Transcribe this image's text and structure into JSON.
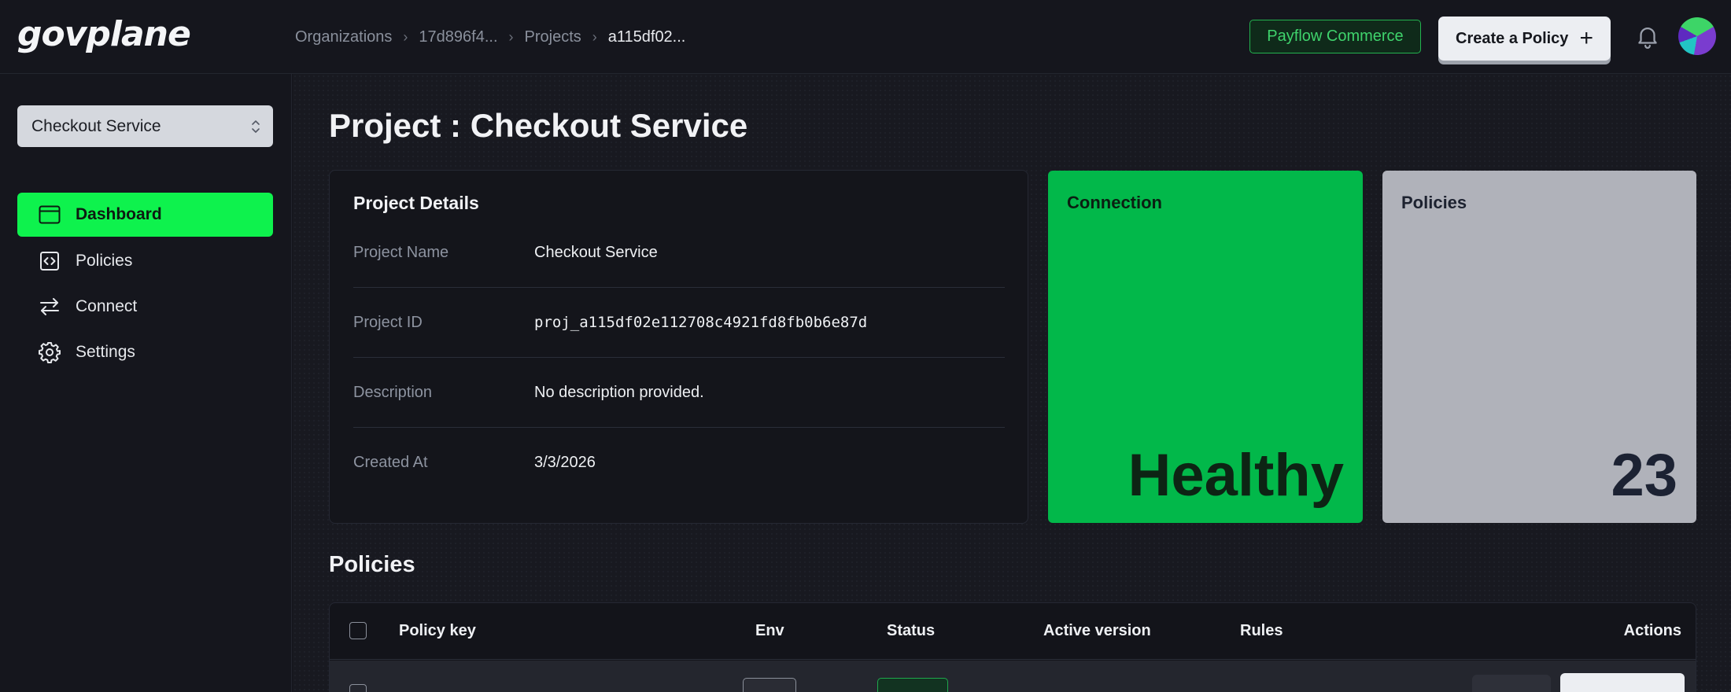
{
  "app": {
    "logo": "govplane"
  },
  "breadcrumb": [
    {
      "label": "Organizations"
    },
    {
      "label": "17d896f4..."
    },
    {
      "label": "Projects"
    },
    {
      "label": "a115df02..."
    }
  ],
  "header": {
    "org_name": "Payflow Commerce",
    "create_label": "Create a Policy",
    "create_icon": "plus-icon",
    "bell_icon": "bell-icon",
    "avatar_icon": "avatar"
  },
  "sidebar": {
    "project_select": {
      "value": "Checkout Service",
      "icon": "chevron-up-down-icon"
    },
    "items": [
      {
        "label": "Dashboard",
        "icon": "browser-window-icon",
        "active": true
      },
      {
        "label": "Policies",
        "icon": "code-file-icon",
        "active": false
      },
      {
        "label": "Connect",
        "icon": "arrows-left-right-icon",
        "active": false
      },
      {
        "label": "Settings",
        "icon": "gear-icon",
        "active": false
      }
    ]
  },
  "main": {
    "title": "Project : Checkout Service",
    "details": {
      "heading": "Project Details",
      "rows": [
        {
          "key": "Project Name",
          "value": "Checkout Service"
        },
        {
          "key": "Project ID",
          "value": "proj_a115df02e112708c4921fd8fb0b6e87d"
        },
        {
          "key": "Description",
          "value": "No description provided."
        },
        {
          "key": "Created At",
          "value": "3/3/2026"
        }
      ]
    },
    "stats": {
      "connection": {
        "label": "Connection",
        "value": "Healthy",
        "color": "#02b84a"
      },
      "policies": {
        "label": "Policies",
        "value": "23",
        "color": "#b0b2ba"
      }
    },
    "policies_section": {
      "title": "Policies",
      "columns": [
        "Policy key",
        "Env",
        "Status",
        "Active version",
        "Rules",
        "Actions"
      ]
    }
  },
  "colors": {
    "accent": "#0ef24d",
    "background": "#14151c",
    "org_pill": "#3fd36c"
  }
}
